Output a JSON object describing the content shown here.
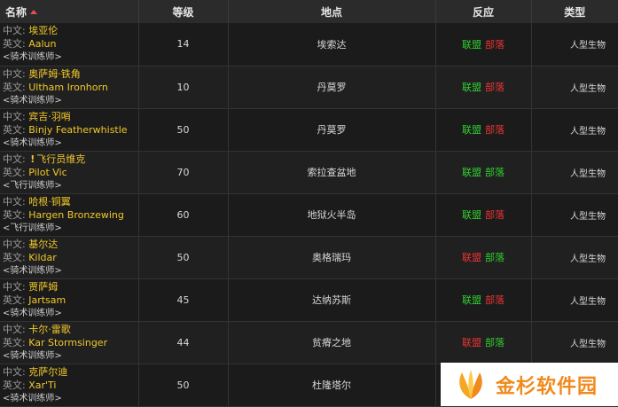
{
  "header": {
    "name": "名称",
    "level": "等级",
    "location": "地点",
    "reaction": "反应",
    "type": "类型"
  },
  "labels": {
    "cn": "中文:",
    "en": "英文:"
  },
  "rows": [
    {
      "cn": "埃亚伦",
      "en": "Aalun",
      "sub": "<骑术训练师>",
      "level": "14",
      "location": "埃索达",
      "react": [
        [
          "联盟",
          "green"
        ],
        [
          "部落",
          "red"
        ]
      ],
      "type": "人型生物"
    },
    {
      "cn": "奥萨姆·铁角",
      "en": "Ultham Ironhorn",
      "sub": "<骑术训练师>",
      "level": "10",
      "location": "丹莫罗",
      "react": [
        [
          "联盟",
          "green"
        ],
        [
          "部落",
          "red"
        ]
      ],
      "type": "人型生物"
    },
    {
      "cn": "宾吉·羽哨",
      "en": "Binjy Featherwhistle",
      "sub": "<骑术训练师>",
      "level": "50",
      "location": "丹莫罗",
      "react": [
        [
          "联盟",
          "green"
        ],
        [
          "部落",
          "red"
        ]
      ],
      "type": "人型生物"
    },
    {
      "cn": "飞行员维克",
      "en": "Pilot Vic",
      "sub": "<飞行训练师>",
      "level": "70",
      "location": "索拉查盆地",
      "react": [
        [
          "联盟",
          "green"
        ],
        [
          "部落",
          "green"
        ]
      ],
      "type": "人型生物",
      "quest": true
    },
    {
      "cn": "哈根·铜翼",
      "en": "Hargen Bronzewing",
      "sub": "<飞行训练师>",
      "level": "60",
      "location": "地狱火半岛",
      "react": [
        [
          "联盟",
          "green"
        ],
        [
          "部落",
          "red"
        ]
      ],
      "type": "人型生物"
    },
    {
      "cn": "基尔达",
      "en": "Kildar",
      "sub": "<骑术训练师>",
      "level": "50",
      "location": "奥格瑞玛",
      "react": [
        [
          "联盟",
          "red"
        ],
        [
          "部落",
          "green"
        ]
      ],
      "type": "人型生物"
    },
    {
      "cn": "贾萨姆",
      "en": "Jartsam",
      "sub": "<骑术训练师>",
      "level": "45",
      "location": "达纳苏斯",
      "react": [
        [
          "联盟",
          "green"
        ],
        [
          "部落",
          "red"
        ]
      ],
      "type": "人型生物"
    },
    {
      "cn": "卡尔·雷歌",
      "en": "Kar Stormsinger",
      "sub": "<骑术训练师>",
      "level": "44",
      "location": "贫瘠之地",
      "react": [
        [
          "联盟",
          "red"
        ],
        [
          "部落",
          "green"
        ]
      ],
      "type": "人型生物"
    },
    {
      "cn": "克萨尔迪",
      "en": "Xar'Ti",
      "sub": "<骑术训练师>",
      "level": "50",
      "location": "杜隆塔尔",
      "react": [],
      "type": ""
    }
  ],
  "watermark": {
    "text": "金杉软件园"
  },
  "colors": {
    "faction_green": "#2fd02f",
    "faction_red": "#ee3333",
    "name_gold": "#f2c82a"
  }
}
